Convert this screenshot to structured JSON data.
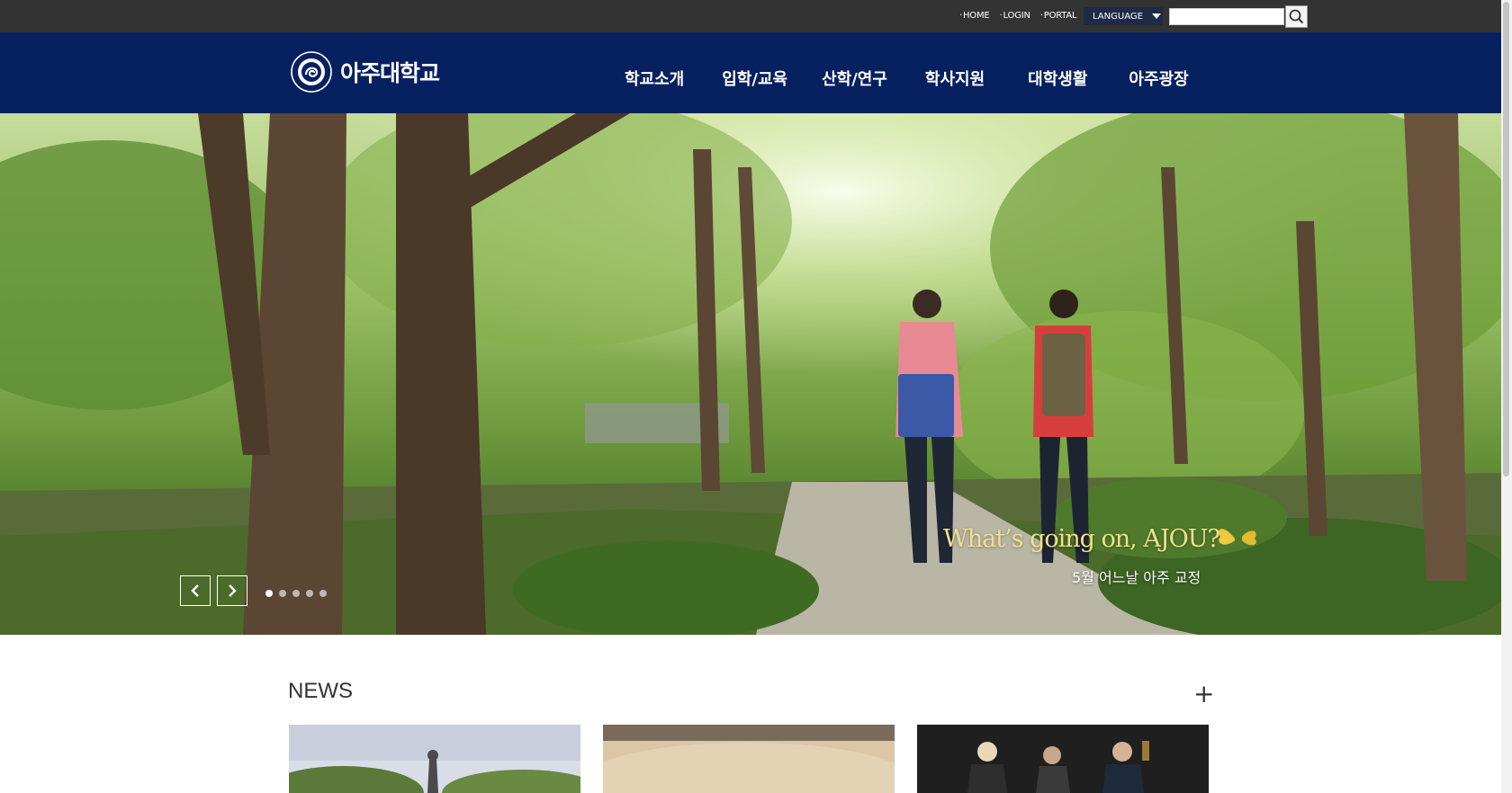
{
  "utility": {
    "links": [
      "HOME",
      "LOGIN",
      "PORTAL"
    ],
    "language_label": "LANGUAGE",
    "search_value": ""
  },
  "nav": {
    "logo_text": "아주대학교",
    "menu": [
      "학교소개",
      "입학/교육",
      "산학/연구",
      "학사지원",
      "대학생활",
      "아주광장"
    ]
  },
  "hero": {
    "headline": "What’s going on, AJOU?",
    "subtitle": "5월 어느날 아주 교정",
    "slide_count": 5,
    "active_slide": 1
  },
  "news": {
    "title": "NEWS",
    "more": "+"
  },
  "icons": {
    "search": "search-icon",
    "language_caret": "caret-down-icon",
    "prev": "chevron-left-icon",
    "next": "chevron-right-icon",
    "butterfly": "butterfly-icon"
  },
  "colors": {
    "utility_bar": "#333333",
    "nav_bar": "#062060",
    "headline": "#f1e08a"
  }
}
